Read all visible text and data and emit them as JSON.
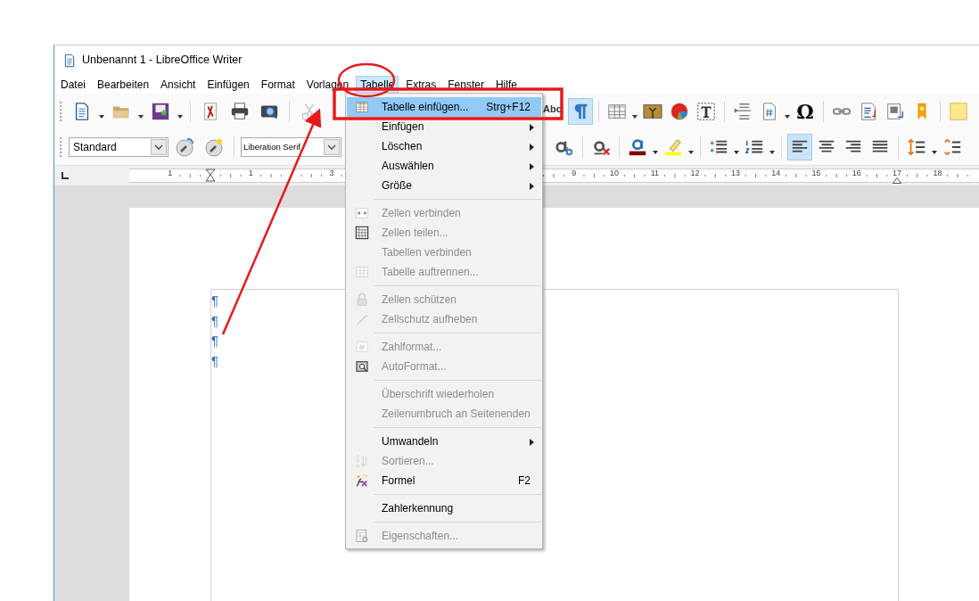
{
  "window": {
    "title": "Unbenannt 1 - LibreOffice Writer"
  },
  "menubar": [
    {
      "label": "Datei",
      "selected": false
    },
    {
      "label": "Bearbeiten",
      "selected": false
    },
    {
      "label": "Ansicht",
      "selected": false
    },
    {
      "label": "Einfügen",
      "selected": false
    },
    {
      "label": "Format",
      "selected": false
    },
    {
      "label": "Vorlagen",
      "selected": false
    },
    {
      "label": "Tabelle",
      "selected": true
    },
    {
      "label": "Extras",
      "selected": false
    },
    {
      "label": "Fenster",
      "selected": false
    },
    {
      "label": "Hilfe",
      "selected": false
    }
  ],
  "toolbar_standard": {
    "left": [
      {
        "kind": "new",
        "dropdown": true,
        "disabled": false
      },
      {
        "kind": "open",
        "dropdown": true,
        "disabled": false
      },
      {
        "kind": "save",
        "dropdown": true,
        "disabled": false
      },
      {
        "kind": "separator"
      },
      {
        "kind": "pdf",
        "dropdown": false,
        "disabled": false
      },
      {
        "kind": "print",
        "dropdown": false,
        "disabled": false
      },
      {
        "kind": "preview",
        "dropdown": false,
        "disabled": false
      },
      {
        "kind": "separator"
      },
      {
        "kind": "cut",
        "dropdown": false,
        "disabled": true
      }
    ],
    "right": [
      {
        "kind": "spellcheck",
        "label": "Abc"
      },
      {
        "kind": "pilcrow",
        "on": true
      },
      {
        "kind": "separator"
      },
      {
        "kind": "table",
        "dropdown": true
      },
      {
        "kind": "image"
      },
      {
        "kind": "chart"
      },
      {
        "kind": "textbox"
      },
      {
        "kind": "separator"
      },
      {
        "kind": "field"
      },
      {
        "kind": "pagenumber",
        "dropdown": true
      },
      {
        "kind": "specialchar",
        "label": "Ω"
      },
      {
        "kind": "separator"
      },
      {
        "kind": "hyperlink"
      },
      {
        "kind": "footnote"
      },
      {
        "kind": "crossref"
      },
      {
        "kind": "bookmark"
      },
      {
        "kind": "separator"
      },
      {
        "kind": "comment"
      }
    ]
  },
  "toolbar_formatting": {
    "paragraph_style": "Standard",
    "font_name": "Liberation Serif",
    "right": [
      {
        "kind": "subscript"
      },
      {
        "kind": "separator"
      },
      {
        "kind": "clearformat"
      },
      {
        "kind": "separator"
      },
      {
        "kind": "fontcolor",
        "dropdown": true
      },
      {
        "kind": "highlight",
        "dropdown": true
      },
      {
        "kind": "separator"
      },
      {
        "kind": "bullets",
        "dropdown": true
      },
      {
        "kind": "numbering",
        "dropdown": true
      },
      {
        "kind": "separator"
      },
      {
        "kind": "align-left",
        "selected": true
      },
      {
        "kind": "align-center",
        "selected": false
      },
      {
        "kind": "align-right",
        "selected": false
      },
      {
        "kind": "align-justify",
        "selected": false
      },
      {
        "kind": "separator"
      },
      {
        "kind": "linespacing",
        "dropdown": true
      },
      {
        "kind": "paraspacing"
      }
    ]
  },
  "ruler": {
    "left_labels": [
      "1"
    ],
    "labels": [
      "1"
    ],
    "labels_after_arrow": [
      "3"
    ],
    "right_labels": [
      "9",
      "10",
      "11",
      "12",
      "13",
      "14",
      "15",
      "16",
      "17",
      "18"
    ]
  },
  "document": {
    "paragraph_marks": [
      "¶",
      "¶",
      "¶",
      "¶"
    ]
  },
  "table_menu": [
    {
      "kind": "item",
      "label": "Tabelle einfügen...",
      "shortcut": "Strg+F12",
      "selected": true,
      "disabled": false
    },
    {
      "kind": "submenu",
      "label": "Einfügen",
      "selected": false,
      "disabled": false
    },
    {
      "kind": "submenu",
      "label": "Löschen",
      "selected": false,
      "disabled": false
    },
    {
      "kind": "submenu",
      "label": "Auswählen",
      "selected": false,
      "disabled": false
    },
    {
      "kind": "submenu",
      "label": "Größe",
      "selected": false,
      "disabled": false
    },
    {
      "kind": "separator"
    },
    {
      "kind": "item",
      "label": "Zellen verbinden",
      "selected": false,
      "disabled": true
    },
    {
      "kind": "item",
      "label": "Zellen teilen...",
      "selected": false,
      "disabled": true
    },
    {
      "kind": "item",
      "label": "Tabellen verbinden",
      "selected": false,
      "disabled": true
    },
    {
      "kind": "item",
      "label": "Tabelle auftrennen...",
      "selected": false,
      "disabled": true
    },
    {
      "kind": "separator"
    },
    {
      "kind": "item",
      "label": "Zellen schützen",
      "selected": false,
      "disabled": true
    },
    {
      "kind": "item",
      "label": "Zellschutz aufheben",
      "selected": false,
      "disabled": true
    },
    {
      "kind": "separator"
    },
    {
      "kind": "item",
      "label": "Zahlformat...",
      "selected": false,
      "disabled": true
    },
    {
      "kind": "item",
      "label": "AutoFormat...",
      "selected": false,
      "disabled": true
    },
    {
      "kind": "separator"
    },
    {
      "kind": "item",
      "label": "Überschrift wiederholen",
      "selected": false,
      "disabled": true
    },
    {
      "kind": "item",
      "label": "Zeilenumbruch an Seitenenden",
      "selected": false,
      "disabled": true
    },
    {
      "kind": "separator"
    },
    {
      "kind": "submenu",
      "label": "Umwandeln",
      "selected": false,
      "disabled": false
    },
    {
      "kind": "item",
      "label": "Sortieren...",
      "selected": false,
      "disabled": true
    },
    {
      "kind": "item",
      "label": "Formel",
      "shortcut": "F2",
      "selected": false,
      "disabled": false
    },
    {
      "kind": "separator"
    },
    {
      "kind": "item",
      "label": "Zahlerkennung",
      "selected": false,
      "disabled": false
    },
    {
      "kind": "separator"
    },
    {
      "kind": "item",
      "label": "Eigenschaften...",
      "selected": false,
      "disabled": true
    }
  ]
}
